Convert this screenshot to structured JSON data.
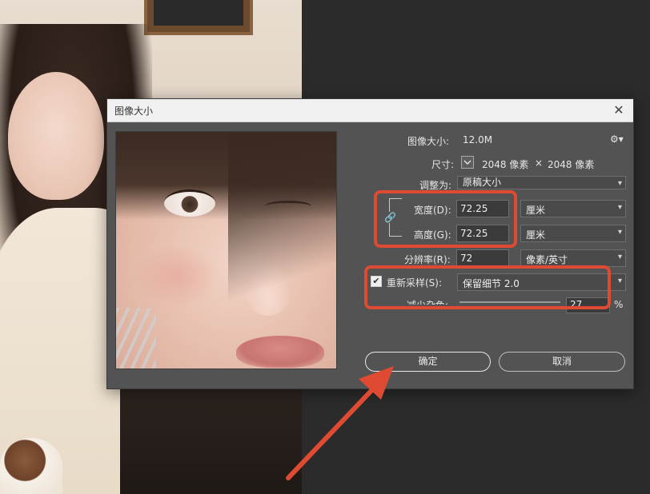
{
  "dialog": {
    "title": "图像大小",
    "close_glyph": "✕"
  },
  "info": {
    "image_size_label": "图像大小:",
    "image_size_value": "12.0M",
    "dimensions_label": "尺寸:",
    "dimensions_width": "2048 像素",
    "dimensions_times": "×",
    "dimensions_height": "2048 像素",
    "gear_icon": "gear-icon"
  },
  "fit_to": {
    "label": "调整为:",
    "value": "原稿大小"
  },
  "width": {
    "label": "宽度(D):",
    "value": "72.25",
    "unit": "厘米"
  },
  "height": {
    "label": "高度(G):",
    "value": "72.25",
    "unit": "厘米"
  },
  "resolution": {
    "label": "分辨率(R):",
    "value": "72",
    "unit": "像素/英寸"
  },
  "resample": {
    "label": "重新采样(S):",
    "checked": true,
    "value": "保留细节 2.0"
  },
  "noise": {
    "label": "减少杂色:",
    "value": "27",
    "unit": "%"
  },
  "buttons": {
    "ok": "确定",
    "cancel": "取消"
  },
  "annotation_color": "#de4a32"
}
